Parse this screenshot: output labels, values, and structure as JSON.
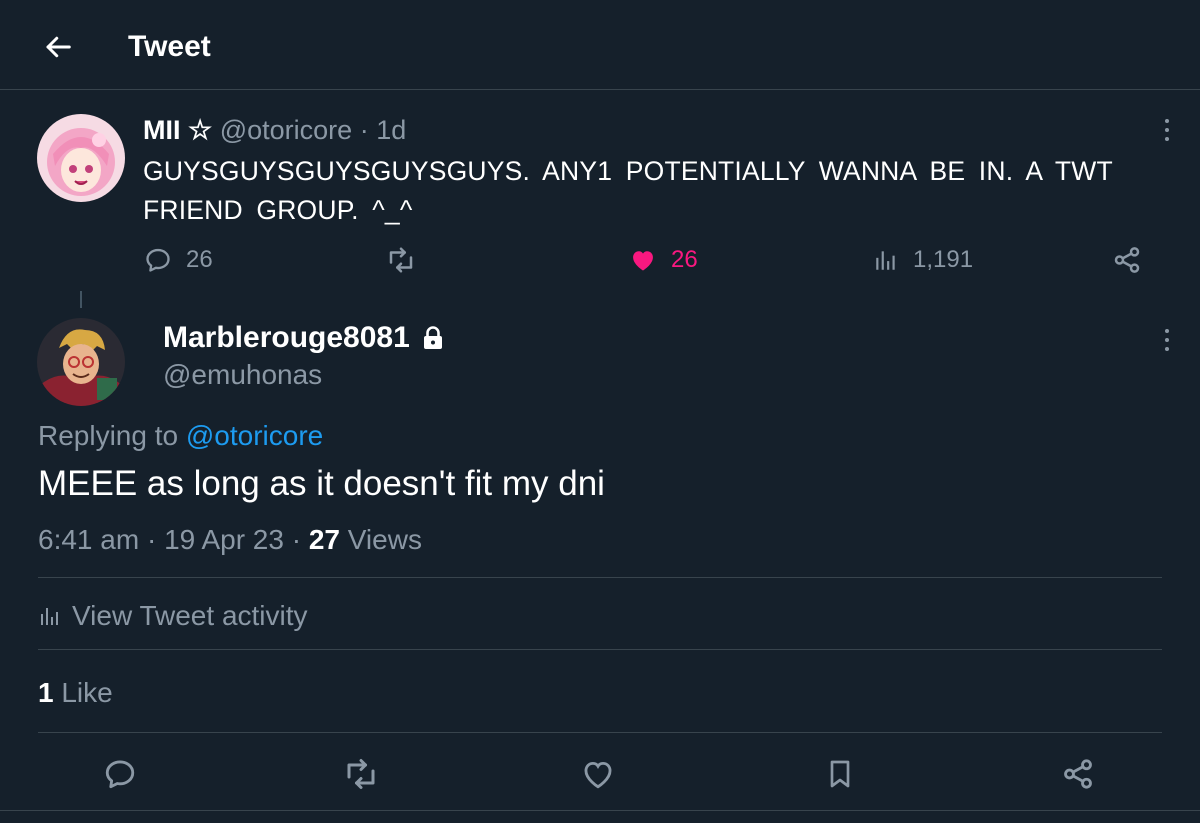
{
  "header": {
    "title": "Tweet",
    "back_icon": "arrow-left-icon"
  },
  "colors": {
    "background": "#15202b",
    "text": "#ffffff",
    "muted": "#8b98a5",
    "link": "#1d9bf0",
    "like_active": "#f91880",
    "divider": "#38444d"
  },
  "parent_tweet": {
    "display_name": "MII ☆",
    "handle": "@otoricore",
    "separator": "·",
    "time_ago": "1d",
    "text": "GUYSGUYSGUYSGUYSGUYS. ANY1 POTENTIALLY WANNA BE IN. A TWT FRIEND GROUP. ^_^",
    "actions": {
      "replies": "26",
      "likes": "26",
      "views": "1,191"
    },
    "liked": true
  },
  "reply_tweet": {
    "display_name": "Marblerouge8081",
    "handle": "@emuhonas",
    "protected_icon": "lock-icon",
    "replying_prefix": "Replying to",
    "replying_handle": "@otoricore",
    "text": "MEEE as long as it doesn't fit my dni",
    "time": "6:41 am",
    "date": "19 Apr 23",
    "separator": "·",
    "views_count": "27",
    "views_label": "Views",
    "activity_label": "View Tweet activity",
    "likes_count": "1",
    "likes_label": "Like"
  },
  "bottom_actions": [
    "reply-icon",
    "retweet-icon",
    "like-icon",
    "bookmark-icon",
    "share-icon"
  ]
}
